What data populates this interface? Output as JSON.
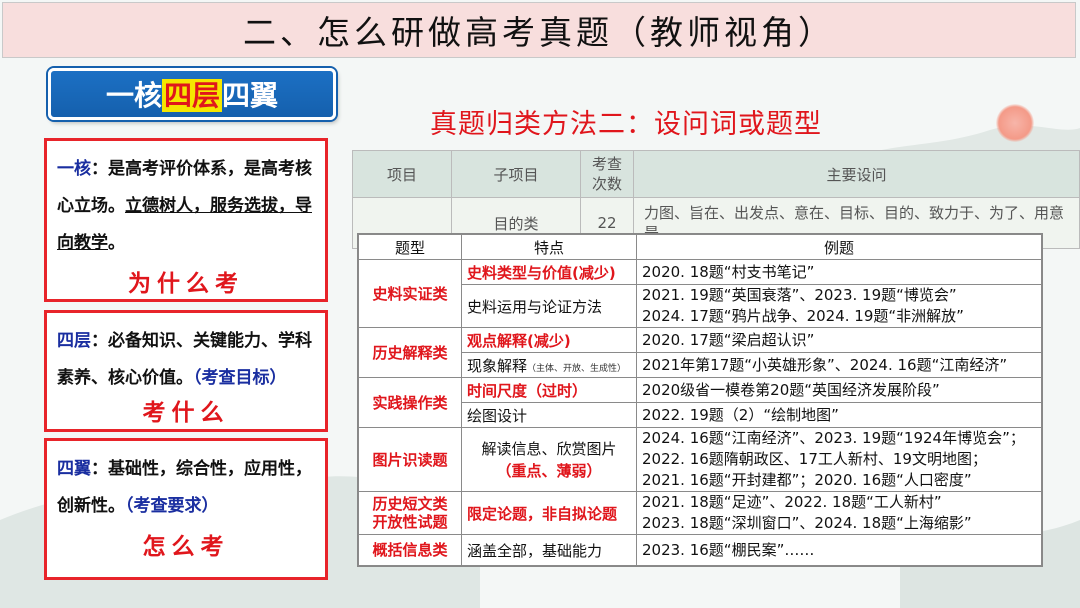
{
  "title": "二、怎么研做高考真题（教师视角）",
  "badge": {
    "pre": "一核",
    "highlight": "四层",
    "post": "四翼"
  },
  "boxes": [
    {
      "keyword": "一核",
      "text": "：是高考评价体系，是高考核心立场。",
      "underlined": "立德树人，服务选拔，导向教学",
      "tail": "。",
      "question": "为什么考"
    },
    {
      "keyword": "四层",
      "text": "：必备知识、关键能力、学科素养、核心价值。",
      "note": "（考查目标）",
      "question": "考什么"
    },
    {
      "keyword": "四翼",
      "text": "：基础性，综合性，应用性，创新性。",
      "note": "（考查要求）",
      "question": "怎么考"
    }
  ],
  "heading": "真题归类方法二：设问词或题型",
  "back_table": {
    "headers": [
      "项目",
      "子项目",
      "考查次数",
      "主要设问"
    ],
    "row1": {
      "sub": "目的类",
      "count": "22",
      "main": "力图、旨在、出发点、意在、目标、目的、致力于、为了、用意是"
    }
  },
  "table": {
    "headers": [
      "题型",
      "特点",
      "例题"
    ],
    "groups": [
      {
        "category": "史料实证类",
        "rows": [
          {
            "feature": "史料类型与价值(减少)",
            "red": true,
            "example": [
              "2020. 18题“村支书笔记”"
            ]
          },
          {
            "feature": "史料运用与论证方法",
            "red": false,
            "example": [
              "2021. 19题“英国衰落”、2023. 19题“博览会”",
              "2024. 17题“鸦片战争、2024. 19题“非洲解放”"
            ]
          }
        ]
      },
      {
        "category": "历史解释类",
        "rows": [
          {
            "feature": "观点解释(减少)",
            "red": true,
            "example": [
              "2020. 17题“梁启超认识”"
            ]
          },
          {
            "feature": "现象解释",
            "small": "（主体、开放、生成性）",
            "red": false,
            "example": [
              "2021年第17题“小英雄形象”、2024. 16题“江南经济”"
            ]
          }
        ]
      },
      {
        "category": "实践操作类",
        "rows": [
          {
            "feature": "时间尺度（过时）",
            "red": true,
            "example": [
              "2020级省一模卷第20题“英国经济发展阶段”"
            ]
          },
          {
            "feature": "绘图设计",
            "red": false,
            "example": [
              "2022. 19题（2）“绘制地图”"
            ]
          }
        ]
      },
      {
        "category": "图片识读题",
        "rows": [
          {
            "feature": "解读信息、欣赏图片",
            "feature2": "（重点、薄弱）",
            "center": true,
            "example": [
              "2024. 16题“江南经济”、2023. 19题“1924年博览会”；",
              "2022. 16题隋朝政区、17工人新村、19文明地图；",
              "2021. 16题“开封建都”；2020. 16题“人口密度”"
            ]
          }
        ]
      },
      {
        "category": "历史短文类开放性试题",
        "rows": [
          {
            "feature": "限定论题，非自拟论题",
            "red": true,
            "example": [
              "2021. 18题“足迹”、2022. 18题“工人新村”",
              "2023. 18题“深圳窗口”、2024. 18题“上海缩影”"
            ]
          }
        ]
      },
      {
        "category": "概括信息类",
        "rows": [
          {
            "feature": "涵盖全部，基础能力",
            "red": false,
            "example": [
              "2023. 16题“棚民案”……"
            ]
          }
        ]
      }
    ]
  },
  "colors": {
    "accent_red": "#e0161c",
    "badge_blue": "#1560ad",
    "keyword_blue": "#1a2ea0"
  }
}
